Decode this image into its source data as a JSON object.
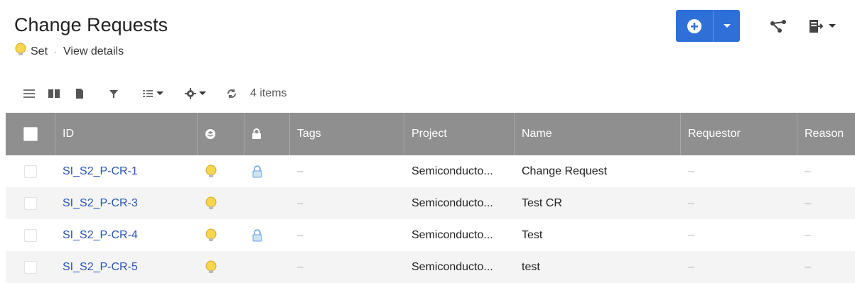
{
  "header": {
    "title": "Change Requests",
    "set_label": "Set",
    "separator": "·",
    "view_details": "View details"
  },
  "toolbar": {
    "items_count": "4 items"
  },
  "table": {
    "columns": {
      "id": "ID",
      "tags": "Tags",
      "project": "Project",
      "name": "Name",
      "requestor": "Requestor",
      "reason": "Reason"
    },
    "rows": [
      {
        "id": "SI_S2_P-CR-1",
        "tags": "–",
        "project": "Semiconducto...",
        "name": "Change Request",
        "requestor": "–",
        "reason": "–"
      },
      {
        "id": "SI_S2_P-CR-3",
        "tags": "–",
        "project": "Semiconducto...",
        "name": "Test CR",
        "requestor": "–",
        "reason": "–"
      },
      {
        "id": "SI_S2_P-CR-4",
        "tags": "–",
        "project": "Semiconducto...",
        "name": "Test",
        "requestor": "–",
        "reason": "–"
      },
      {
        "id": "SI_S2_P-CR-5",
        "tags": "–",
        "project": "Semiconducto...",
        "name": "test",
        "requestor": "–",
        "reason": "–"
      }
    ]
  },
  "colors": {
    "primary_button": "#2f6fd8",
    "header_bg": "#8f8f8f",
    "link": "#2a55b3",
    "bulb": "#f2c33a",
    "lock": "#6aa6e0"
  }
}
